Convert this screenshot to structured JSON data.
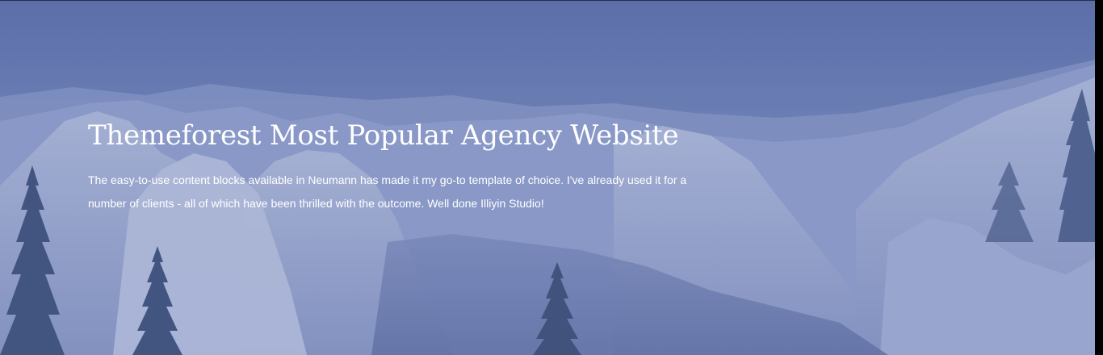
{
  "hero": {
    "title": "Themeforest Most Popular Agency Website",
    "text": "The easy-to-use content blocks available in Neumann has made it my go-to template of choice. I've already used it for a number of clients - all of which have been thrilled with the outcome. Well done Illiyin Studio!",
    "background_image": "mountain-valley-landscape",
    "overlay_color": "#5a6fb0"
  }
}
